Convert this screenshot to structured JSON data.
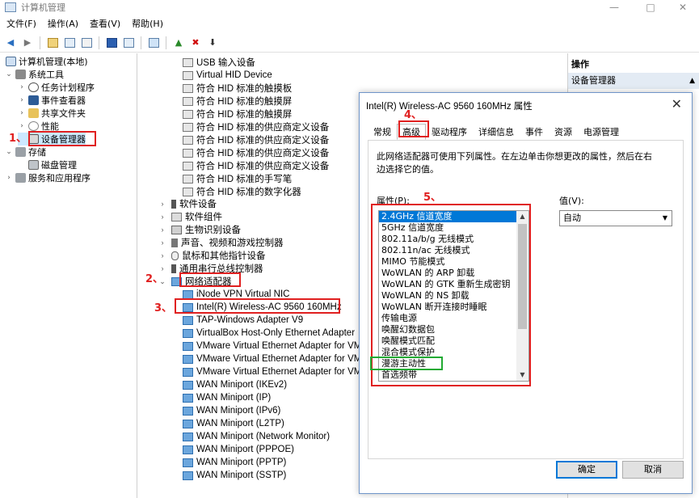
{
  "window": {
    "title": "计算机管理"
  },
  "menu": [
    "文件(F)",
    "操作(A)",
    "查看(V)",
    "帮助(H)"
  ],
  "tree": {
    "root": "计算机管理(本地)",
    "system_tools": "系统工具",
    "task_scheduler": "任务计划程序",
    "event_viewer": "事件查看器",
    "shared_folders": "共享文件夹",
    "performance": "性能",
    "device_manager": "设备管理器",
    "storage": "存储",
    "disk_management": "磁盘管理",
    "services": "服务和应用程序"
  },
  "devices": {
    "hid": [
      "USB 输入设备",
      "Virtual HID Device",
      "符合 HID 标准的触摸板",
      "符合 HID 标准的触摸屏",
      "符合 HID 标准的触摸屏",
      "符合 HID 标准的供应商定义设备",
      "符合 HID 标准的供应商定义设备",
      "符合 HID 标准的供应商定义设备",
      "符合 HID 标准的供应商定义设备",
      "符合 HID 标准的手写笔",
      "符合 HID 标准的数字化器"
    ],
    "categories": [
      "软件设备",
      "软件组件",
      "生物识别设备",
      "声音、视频和游戏控制器",
      "鼠标和其他指针设备",
      "通用串行总线控制器"
    ],
    "network_category": "网络适配器",
    "network": [
      "iNode VPN Virtual NIC",
      "Intel(R) Wireless-AC 9560 160MHz",
      "TAP-Windows Adapter V9",
      "VirtualBox Host-Only Ethernet Adapter",
      "VMware Virtual Ethernet Adapter for VMne",
      "VMware Virtual Ethernet Adapter for VMne",
      "VMware Virtual Ethernet Adapter for VMne",
      "WAN Miniport (IKEv2)",
      "WAN Miniport (IP)",
      "WAN Miniport (IPv6)",
      "WAN Miniport (L2TP)",
      "WAN Miniport (Network Monitor)",
      "WAN Miniport (PPPOE)",
      "WAN Miniport (PPTP)",
      "WAN Miniport (SSTP)"
    ]
  },
  "actions": {
    "header": "操作",
    "device_manager": "设备管理器"
  },
  "dialog": {
    "title": "Intel(R) Wireless-AC 9560 160MHz 属性",
    "tabs": [
      "常规",
      "高级",
      "驱动程序",
      "详细信息",
      "事件",
      "资源",
      "电源管理"
    ],
    "description": "此网络适配器可使用下列属性。在左边单击你想更改的属性，然后在右边选择它的值。",
    "property_label": "属性(P):",
    "value_label": "值(V):",
    "properties": [
      "2.4GHz 信道宽度",
      "5GHz 信道宽度",
      "802.11a/b/g 无线模式",
      "802.11n/ac 无线模式",
      "MIMO 节能模式",
      "WoWLAN 的 ARP 卸载",
      "WoWLAN 的 GTK 重新生成密钥",
      "WoWLAN 的 NS 卸载",
      "WoWLAN 断开连接时睡眠",
      "传输电源",
      "唤醒幻数据包",
      "唤醒模式匹配",
      "混合模式保护",
      "漫游主动性",
      "首选频带"
    ],
    "value": "自动",
    "ok": "确定",
    "cancel": "取消"
  },
  "annotations": [
    "1、",
    "2、",
    "3、",
    "4、",
    "5、"
  ]
}
